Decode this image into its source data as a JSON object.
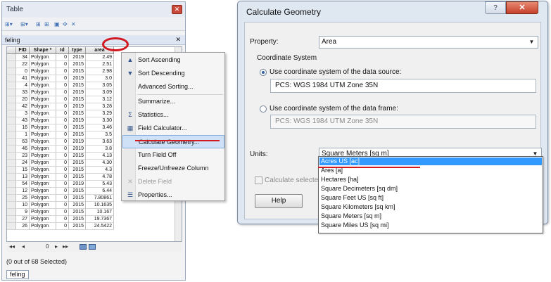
{
  "table_window": {
    "title": "Table",
    "close_glyph": "✕",
    "toolbar": [
      "⊞▾",
      "⊞▾",
      "⊞",
      "⊞",
      "▣",
      "✣",
      "✕"
    ],
    "tab_name": "feling",
    "tab_close": "✕",
    "columns": [
      "FID",
      "Shape *",
      "Id",
      "type",
      "area"
    ],
    "rows": [
      {
        "fid": "34",
        "shape": "Polygon",
        "id": "0",
        "type": "2019",
        "area": "2.49"
      },
      {
        "fid": "22",
        "shape": "Polygon",
        "id": "0",
        "type": "2015",
        "area": "2.51"
      },
      {
        "fid": "0",
        "shape": "Polygon",
        "id": "0",
        "type": "2015",
        "area": "2.98"
      },
      {
        "fid": "41",
        "shape": "Polygon",
        "id": "0",
        "type": "2019",
        "area": "3.0"
      },
      {
        "fid": "4",
        "shape": "Polygon",
        "id": "0",
        "type": "2015",
        "area": "3.05"
      },
      {
        "fid": "33",
        "shape": "Polygon",
        "id": "0",
        "type": "2019",
        "area": "3.09"
      },
      {
        "fid": "20",
        "shape": "Polygon",
        "id": "0",
        "type": "2015",
        "area": "3.12"
      },
      {
        "fid": "42",
        "shape": "Polygon",
        "id": "0",
        "type": "2019",
        "area": "3.28"
      },
      {
        "fid": "3",
        "shape": "Polygon",
        "id": "0",
        "type": "2015",
        "area": "3.29"
      },
      {
        "fid": "43",
        "shape": "Polygon",
        "id": "0",
        "type": "2019",
        "area": "3.30"
      },
      {
        "fid": "16",
        "shape": "Polygon",
        "id": "0",
        "type": "2015",
        "area": "3.46"
      },
      {
        "fid": "1",
        "shape": "Polygon",
        "id": "0",
        "type": "2015",
        "area": "3.5"
      },
      {
        "fid": "63",
        "shape": "Polygon",
        "id": "0",
        "type": "2019",
        "area": "3.63"
      },
      {
        "fid": "46",
        "shape": "Polygon",
        "id": "0",
        "type": "2019",
        "area": "3.8"
      },
      {
        "fid": "23",
        "shape": "Polygon",
        "id": "0",
        "type": "2015",
        "area": "4.13"
      },
      {
        "fid": "24",
        "shape": "Polygon",
        "id": "0",
        "type": "2015",
        "area": "4.30"
      },
      {
        "fid": "15",
        "shape": "Polygon",
        "id": "0",
        "type": "2015",
        "area": "4.3"
      },
      {
        "fid": "13",
        "shape": "Polygon",
        "id": "0",
        "type": "2015",
        "area": "4.78"
      },
      {
        "fid": "54",
        "shape": "Polygon",
        "id": "0",
        "type": "2019",
        "area": "5.43"
      },
      {
        "fid": "12",
        "shape": "Polygon",
        "id": "0",
        "type": "2015",
        "area": "6.44"
      },
      {
        "fid": "25",
        "shape": "Polygon",
        "id": "0",
        "type": "2015",
        "area": "7.80861"
      },
      {
        "fid": "10",
        "shape": "Polygon",
        "id": "0",
        "type": "2015",
        "area": "10.1635"
      },
      {
        "fid": "9",
        "shape": "Polygon",
        "id": "0",
        "type": "2015",
        "area": "10.167"
      },
      {
        "fid": "27",
        "shape": "Polygon",
        "id": "0",
        "type": "2015",
        "area": "19.7367"
      },
      {
        "fid": "26",
        "shape": "Polygon",
        "id": "0",
        "type": "2015",
        "area": "24.5422"
      }
    ],
    "nav": {
      "first": "◂◂",
      "prev": "◂",
      "current": "0",
      "next": "▸",
      "last": "▸▸"
    },
    "status": "(0 out of 68 Selected)",
    "bottom_tab": "feling"
  },
  "context_menu": {
    "items": [
      {
        "label": "Sort Ascending",
        "icon": "sort-ascending-icon",
        "glyph": "▲",
        "highlighted": false,
        "disabled": false
      },
      {
        "label": "Sort Descending",
        "icon": "sort-descending-icon",
        "glyph": "▼",
        "highlighted": false,
        "disabled": false
      },
      {
        "label": "Advanced Sorting...",
        "icon": "",
        "glyph": "",
        "highlighted": false,
        "disabled": false
      },
      {
        "label": "Summarize...",
        "icon": "",
        "glyph": "",
        "highlighted": false,
        "disabled": false
      },
      {
        "label": "Statistics...",
        "icon": "sigma-icon",
        "glyph": "Σ",
        "highlighted": false,
        "disabled": false
      },
      {
        "label": "Field Calculator...",
        "icon": "calculator-icon",
        "glyph": "▦",
        "highlighted": false,
        "disabled": false
      },
      {
        "label": "Calculate Geometry...",
        "icon": "",
        "glyph": "",
        "highlighted": true,
        "disabled": false
      },
      {
        "label": "Turn Field Off",
        "icon": "",
        "glyph": "",
        "highlighted": false,
        "disabled": false
      },
      {
        "label": "Freeze/Unfreeze Column",
        "icon": "",
        "glyph": "",
        "highlighted": false,
        "disabled": false
      },
      {
        "label": "Delete Field",
        "icon": "delete-icon",
        "glyph": "✕",
        "highlighted": false,
        "disabled": true
      },
      {
        "label": "Properties...",
        "icon": "properties-icon",
        "glyph": "☰",
        "highlighted": false,
        "disabled": false
      }
    ]
  },
  "dialog": {
    "title": "Calculate Geometry",
    "help_glyph": "?",
    "close_glyph": "✕",
    "property_label": "Property:",
    "property_value": "Area",
    "coord_system_label": "Coordinate System",
    "radio_source_label": "Use coordinate system of the data source:",
    "source_cs": "PCS: WGS 1984 UTM Zone 35N",
    "radio_frame_label": "Use coordinate system of the data frame:",
    "frame_cs": "PCS: WGS 1984 UTM Zone 35N",
    "units_label": "Units:",
    "units_value": "Square Meters [sq m]",
    "calc_selected_label": "Calculate selecte",
    "help_button": "Help",
    "units_options": [
      "Acres US [ac]",
      "Ares [a]",
      "Hectares [ha]",
      "Square Decimeters [sq dm]",
      "Square Feet US [sq ft]",
      "Square Kilometers [sq km]",
      "Square Meters [sq m]",
      "Square Miles US [sq mi]"
    ],
    "selected_option_index": 0
  },
  "colors": {
    "highlight": "#cfe1f7",
    "selection": "#3399ff",
    "annotation_red": "#d1191f"
  }
}
